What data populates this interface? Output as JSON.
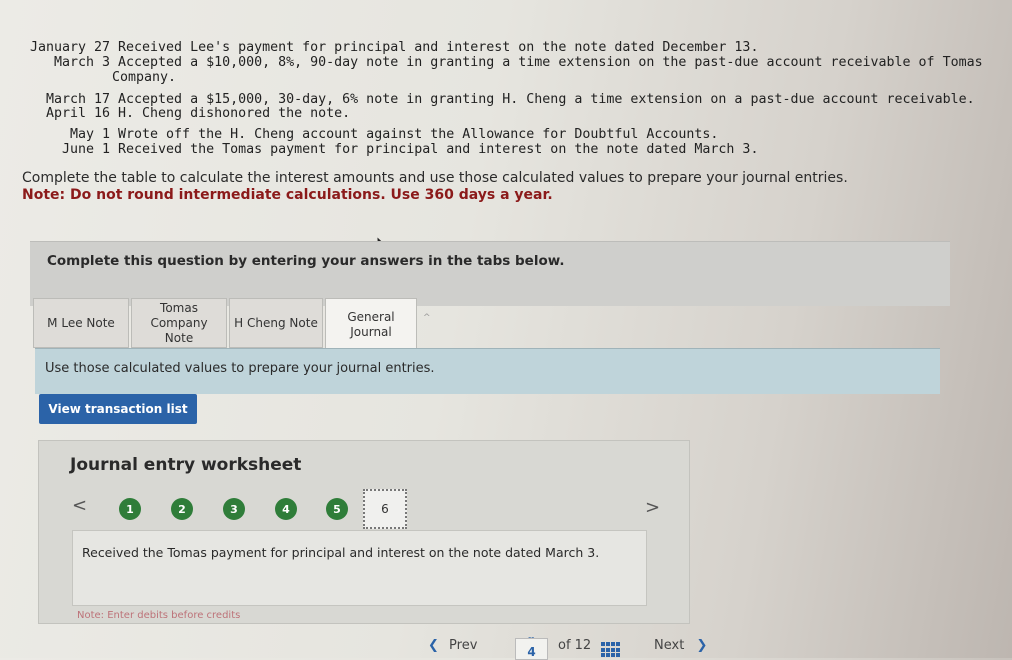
{
  "transactions": [
    {
      "date": "January 27",
      "text": "Received Lee's payment for principal and interest on the note dated December 13."
    },
    {
      "date": "March 3",
      "text": "Accepted a $10,000, 8%, 90-day note in granting a time extension on the past-due account receivable of Tomas",
      "continuation": "Company."
    },
    {
      "date": "March 17",
      "text": "Accepted a $15,000, 30-day, 6% note in granting H. Cheng a time extension on a past-due account receivable."
    },
    {
      "date": "April 16",
      "text": "H. Cheng dishonored the note."
    },
    {
      "date": "May 1",
      "text": "Wrote off the H. Cheng account against the Allowance for Doubtful Accounts."
    },
    {
      "date": "June 1",
      "text": "Received the Tomas payment for principal and interest on the note dated March 3."
    }
  ],
  "intro": {
    "instruction": "Complete the table to calculate the interest amounts and use those calculated values to prepare your journal entries.",
    "note": "Note: Do not round intermediate calculations. Use 360 days a year."
  },
  "banner": "Complete this question by entering your answers in the tabs below.",
  "tabs": [
    {
      "label_line1": "M Lee Note",
      "label_line2": "",
      "active": false
    },
    {
      "label_line1": "Tomas",
      "label_line2": "Company Note",
      "active": false
    },
    {
      "label_line1": "H Cheng Note",
      "label_line2": "",
      "active": false
    },
    {
      "label_line1": "General",
      "label_line2": "Journal",
      "active": true
    }
  ],
  "tab_instruction": "Use those calculated values to prepare your journal entries.",
  "view_transaction_button": "View transaction list",
  "worksheet": {
    "title": "Journal entry worksheet",
    "prev_arrow": "<",
    "next_arrow": ">",
    "steps": [
      "1",
      "2",
      "3",
      "4",
      "5"
    ],
    "current_step": "6",
    "description": "Received the Tomas payment for principal and interest on the note dated March 3.",
    "note": "Note: Enter debits before credits"
  },
  "footer": {
    "prev_label": "Prev",
    "current_page": "4",
    "of_label": "of 12",
    "next_label": "Next"
  },
  "colors": {
    "accent_blue": "#2b63a8",
    "step_complete_green": "#2f7d39",
    "note_red": "#8b1a1a",
    "instruction_bg": "#bfd4da"
  }
}
